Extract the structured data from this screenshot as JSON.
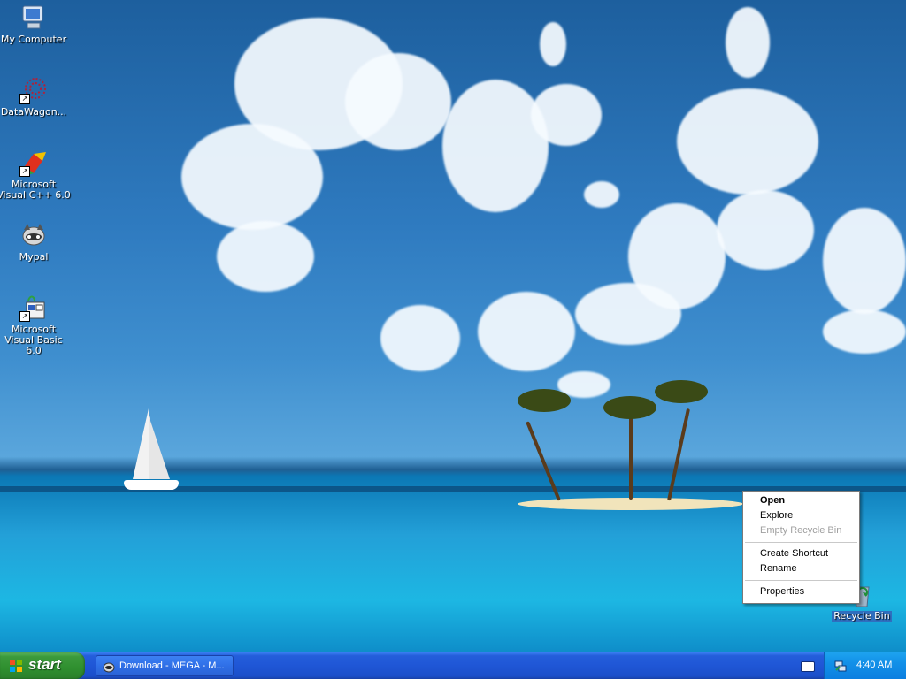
{
  "desktop": {
    "icons": [
      {
        "label": "My Computer",
        "icon": "my-computer-icon"
      },
      {
        "label": "DataWagon...",
        "icon": "datawagon-icon"
      },
      {
        "label": "Microsoft Visual C++ 6.0",
        "icon": "visual-cpp-icon"
      },
      {
        "label": "Mypal",
        "icon": "mypal-icon"
      },
      {
        "label": "Microsoft Visual Basic 6.0",
        "icon": "visual-basic-icon"
      },
      {
        "label": "Recycle Bin",
        "icon": "recycle-bin-icon"
      }
    ]
  },
  "context_menu": {
    "items": [
      {
        "label": "Open",
        "bold": true,
        "enabled": true
      },
      {
        "label": "Explore",
        "enabled": true
      },
      {
        "label": "Empty Recycle Bin",
        "enabled": false
      },
      {
        "label": "Create Shortcut",
        "enabled": true
      },
      {
        "label": "Rename",
        "enabled": true
      },
      {
        "label": "Properties",
        "enabled": true
      }
    ]
  },
  "taskbar": {
    "start_label": "start",
    "task_button_label": "Download - MEGA - M...",
    "clock": "4:40 AM"
  },
  "colors": {
    "taskbar_blue": "#245edb",
    "start_green": "#3c9a3c",
    "tray_blue": "#1290e8"
  }
}
